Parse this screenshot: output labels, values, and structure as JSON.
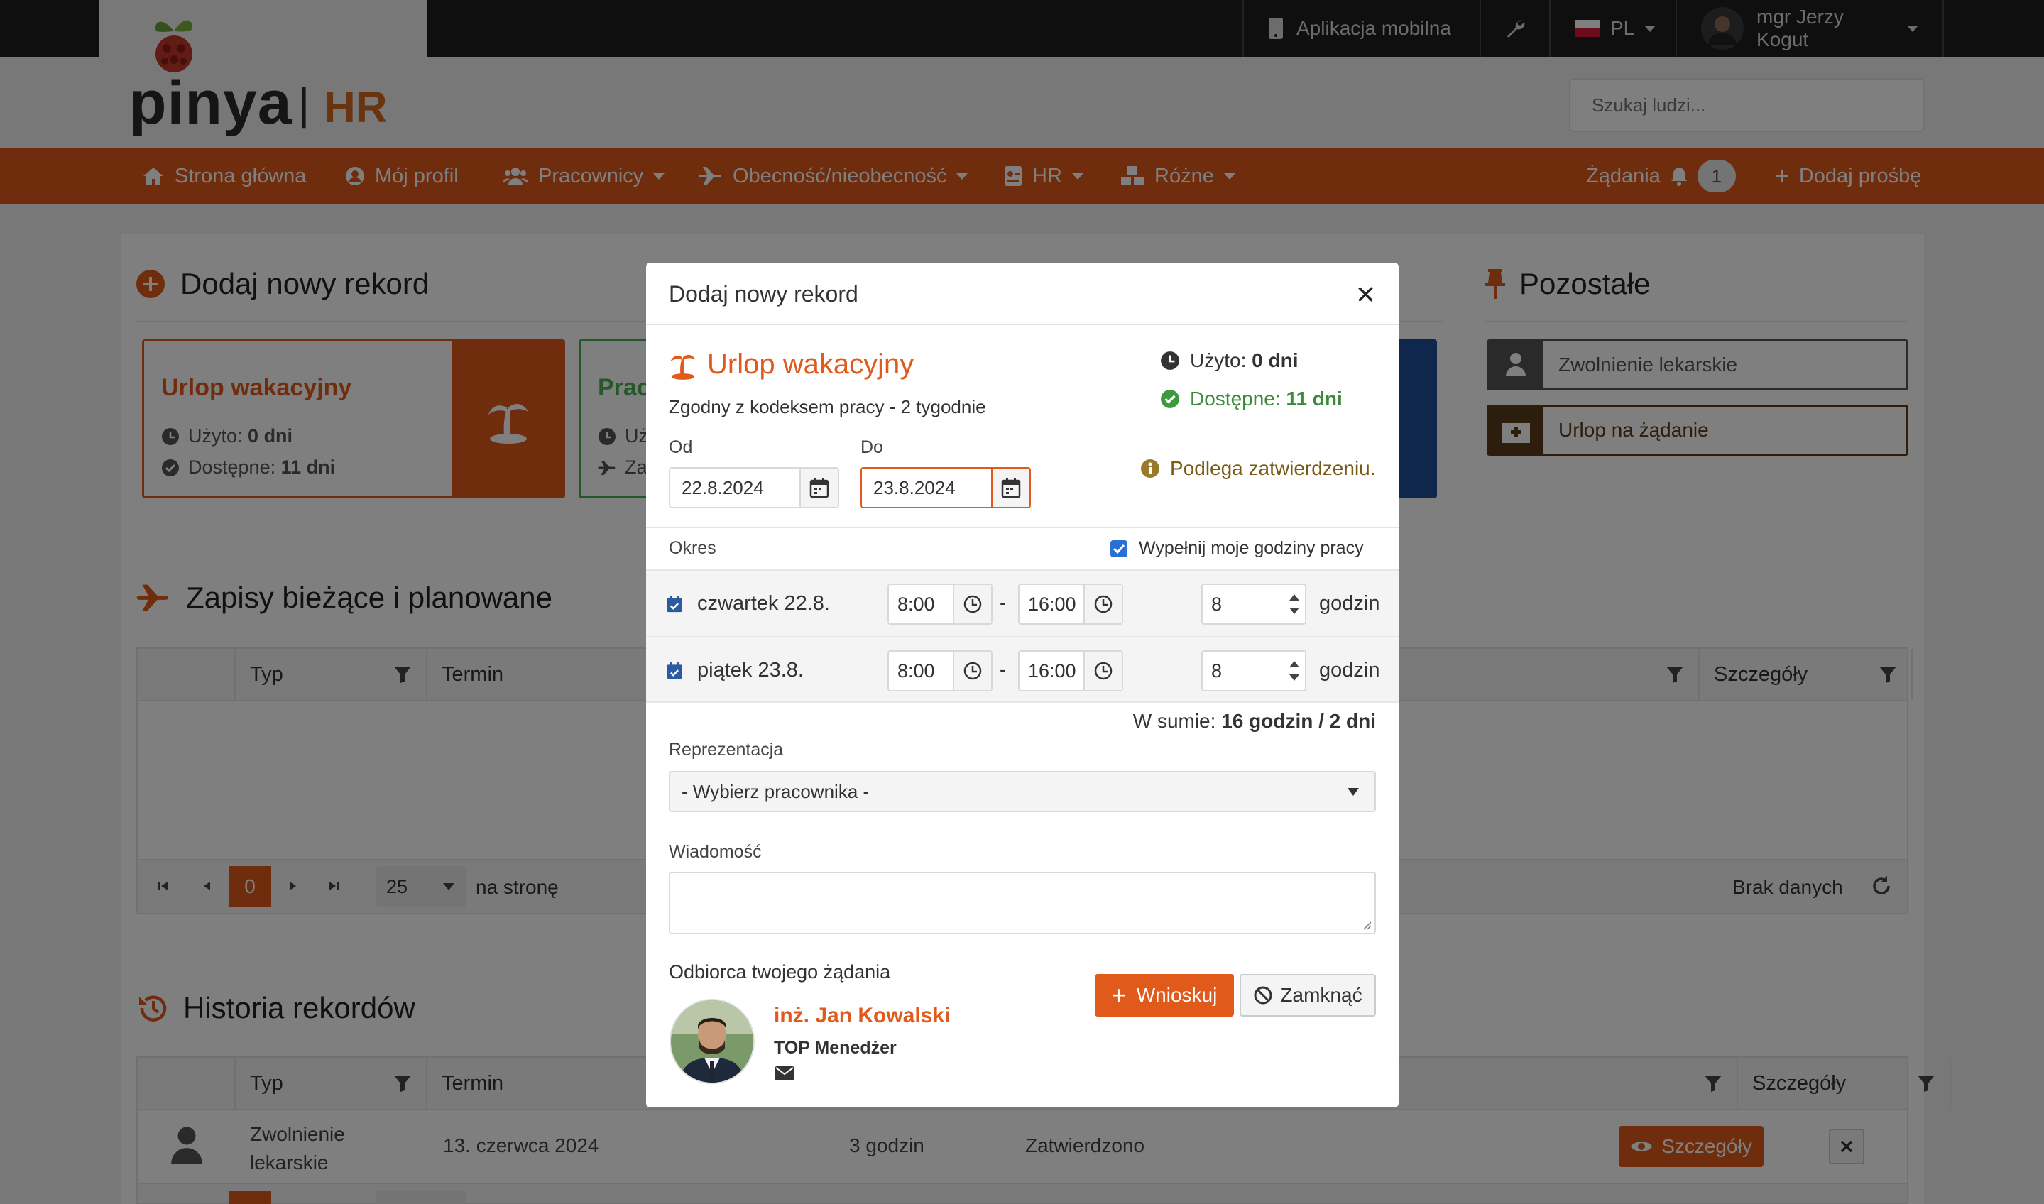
{
  "topbar": {
    "mobile_app": "Aplikacja mobilna",
    "language": "PL",
    "user": "mgr Jerzy Kogut"
  },
  "header": {
    "logo_main": "pinya",
    "logo_sep": "|",
    "logo_sub": "HR",
    "search_placeholder": "Szukaj ludzi..."
  },
  "nav": {
    "items": [
      {
        "label": "Strona główna"
      },
      {
        "label": "Mój profil"
      },
      {
        "label": "Pracownicy"
      },
      {
        "label": "Obecność/nieobecność"
      },
      {
        "label": "HR"
      },
      {
        "label": "Różne"
      }
    ],
    "requests_label": "Żądania",
    "requests_count": "1",
    "add_request": "Dodaj prośbę"
  },
  "background": {
    "add_record_title": "Dodaj nowy rekord",
    "card1": {
      "title": "Urlop wakacyjny",
      "used_label": "Użyto:",
      "used_value": "0 dni",
      "avail_label": "Dostępne:",
      "avail_value": "11 dni"
    },
    "card2": {
      "title": "Prac",
      "line1": "Uż",
      "line2": "Za"
    },
    "other_title": "Pozostałe",
    "other_items": [
      {
        "label": "Zwolnienie lekarskie"
      },
      {
        "label": "Urlop na żądanie"
      }
    ],
    "current_title": "Zapisy bieżące i planowane",
    "grid1": {
      "col_type": "Typ",
      "col_term": "Termin",
      "col_details": "Szczegóły"
    },
    "pager": {
      "page": "0",
      "per_page": "25",
      "per_page_label": "na stronę",
      "no_data": "Brak danych"
    },
    "history_title": "Historia rekordów",
    "grid2": {
      "col_type": "Typ",
      "col_term": "Termin",
      "col_details": "Szczegóły",
      "row": {
        "type_line1": "Zwolnienie",
        "type_line2": "lekarskie",
        "term": "13. czerwca 2024",
        "duration": "3 godzin",
        "status": "Zatwierdzono",
        "details_btn": "Szczegóły"
      }
    }
  },
  "modal": {
    "title": "Dodaj nowy rekord",
    "close": "×",
    "leave_type": "Urlop wakacyjny",
    "leave_desc": "Zgodny z kodeksem pracy - 2 tygodnie",
    "used_label": "Użyto:",
    "used_value": "0 dni",
    "avail_label": "Dostępne:",
    "avail_value": "11 dni",
    "approval_note": "Podlega zatwierdzeniu.",
    "from_label": "Od",
    "from_value": "22.8.2024",
    "to_label": "Do",
    "to_value": "23.8.2024",
    "period_label": "Okres",
    "fill_hours_label": "Wypełnij moje godziny pracy",
    "days": [
      {
        "day": "czwartek 22.8.",
        "start": "8:00",
        "end": "16:00",
        "hours": "8",
        "unit": "godzin"
      },
      {
        "day": "piątek 23.8.",
        "start": "8:00",
        "end": "16:00",
        "hours": "8",
        "unit": "godzin"
      }
    ],
    "dash": "-",
    "total_label": "W sumie:",
    "total_value": "16 godzin / 2 dni",
    "representation_label": "Reprezentacja",
    "representation_value": "- Wybierz pracownika -",
    "message_label": "Wiadomość",
    "recipient_label": "Odbiorca twojego żądania",
    "recipient_name": "inż. Jan Kowalski",
    "recipient_role": "TOP Menedżer",
    "submit": "Wnioskuj",
    "cancel": "Zamknąć"
  },
  "colors": {
    "accent": "#e05a1c",
    "green": "#4caf50",
    "dark_brown": "#5a3a1a",
    "blue": "#1f4e9a"
  }
}
